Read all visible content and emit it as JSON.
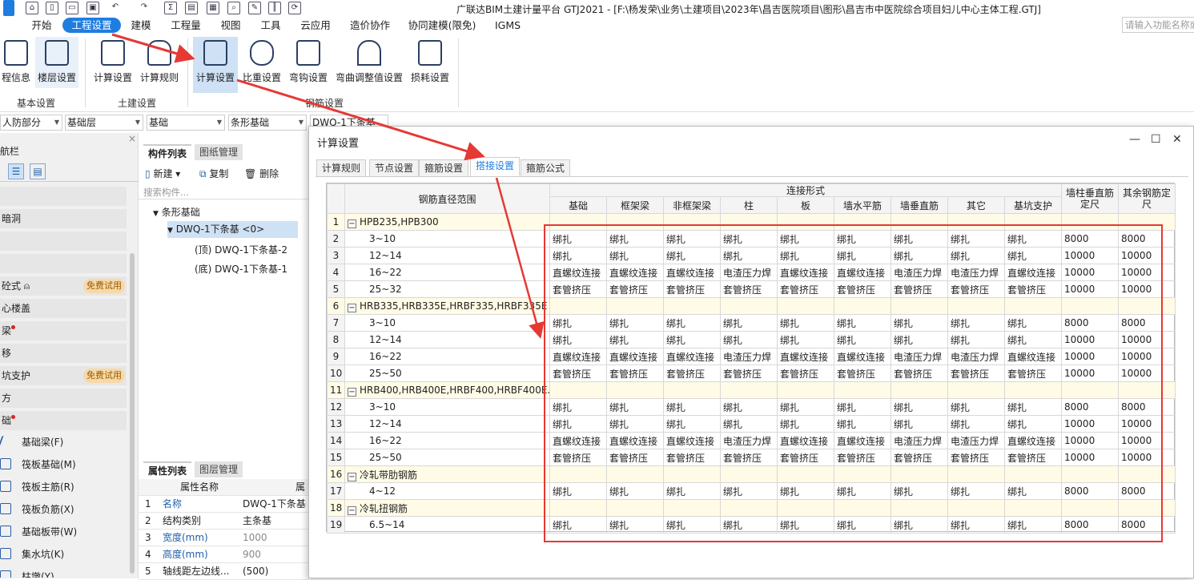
{
  "window": {
    "title": "广联达BIM土建计量平台 GTJ2021 - [F:\\杨发荣\\业务\\土建项目\\2023年\\昌吉医院项目\\图形\\昌吉市中医院综合项目妇儿中心主体工程.GTJ]"
  },
  "menu": {
    "items": [
      "开始",
      "工程设置",
      "建模",
      "工程量",
      "视图",
      "工具",
      "云应用",
      "造价协作",
      "协同建模(限免)",
      "IGMS"
    ],
    "active": "工程设置",
    "search_placeholder": "请输入功能名称或"
  },
  "ribbon": {
    "buttons": [
      "程信息",
      "楼层设置",
      "计算设置",
      "计算规则",
      "计算设置",
      "比重设置",
      "弯钩设置",
      "弯曲调整值设置",
      "损耗设置"
    ],
    "groups": [
      "基本设置",
      "土建设置",
      "钢筋设置"
    ]
  },
  "dropdowns": [
    "人防部分",
    "基础层",
    "基础",
    "条形基础",
    "DWQ-1下条基"
  ],
  "leftnav": {
    "title": "航栏",
    "items": [
      "",
      "暗洞",
      "",
      "",
      "砼式",
      "心楼盖",
      "梁",
      "移",
      "坑支护",
      "方",
      "础"
    ],
    "badge": "免费试用",
    "subitems": [
      "基础梁(F)",
      "筏板基础(M)",
      "筏板主筋(R)",
      "筏板负筋(X)",
      "基础板带(W)",
      "集水坑(K)",
      "柱墩(Y)"
    ]
  },
  "component_panel": {
    "tabs": [
      "构件列表",
      "图纸管理"
    ],
    "toolbar": [
      "新建",
      "复制",
      "删除"
    ],
    "search_placeholder": "搜索构件...",
    "tree": [
      "条形基础",
      "DWQ-1下条基 <0>",
      "(顶) DWQ-1下条基-2",
      "(底) DWQ-1下条基-1"
    ]
  },
  "property_panel": {
    "tabs": [
      "属性列表",
      "图层管理"
    ],
    "header": [
      "属性名称",
      "属"
    ],
    "rows": [
      [
        "1",
        "名称",
        "DWQ-1下条基"
      ],
      [
        "2",
        "结构类别",
        "主条基"
      ],
      [
        "3",
        "宽度(mm)",
        "1000"
      ],
      [
        "4",
        "高度(mm)",
        "900"
      ],
      [
        "5",
        "轴线距左边线...",
        "(500)"
      ]
    ]
  },
  "dialog": {
    "title": "计算设置",
    "tabs": [
      "计算规则",
      "节点设置",
      "箍筋设置",
      "搭接设置",
      "箍筋公式"
    ],
    "active_tab": "搭接设置",
    "table": {
      "header_range": "钢筋直径范围",
      "header_group": "连接形式",
      "columns": [
        "基础",
        "框架梁",
        "非框架梁",
        "柱",
        "板",
        "墙水平筋",
        "墙垂直筋",
        "其它",
        "基坑支护"
      ],
      "extra_columns": [
        "墙柱垂直筋定尺",
        "其余钢筋定尺"
      ],
      "rows": [
        {
          "n": "1",
          "group": true,
          "label": "HPB235,HPB300"
        },
        {
          "n": "2",
          "label": "3~10",
          "cells": [
            "绑扎",
            "绑扎",
            "绑扎",
            "绑扎",
            "绑扎",
            "绑扎",
            "绑扎",
            "绑扎",
            "绑扎",
            "8000",
            "8000"
          ]
        },
        {
          "n": "3",
          "label": "12~14",
          "cells": [
            "绑扎",
            "绑扎",
            "绑扎",
            "绑扎",
            "绑扎",
            "绑扎",
            "绑扎",
            "绑扎",
            "绑扎",
            "10000",
            "10000"
          ]
        },
        {
          "n": "4",
          "label": "16~22",
          "cells": [
            "直螺纹连接",
            "直螺纹连接",
            "直螺纹连接",
            "电渣压力焊",
            "直螺纹连接",
            "直螺纹连接",
            "电渣压力焊",
            "电渣压力焊",
            "直螺纹连接",
            "10000",
            "10000"
          ]
        },
        {
          "n": "5",
          "label": "25~32",
          "cells": [
            "套管挤压",
            "套管挤压",
            "套管挤压",
            "套管挤压",
            "套管挤压",
            "套管挤压",
            "套管挤压",
            "套管挤压",
            "套管挤压",
            "10000",
            "10000"
          ]
        },
        {
          "n": "6",
          "group": true,
          "label": "HRB335,HRB335E,HRBF335,HRBF335E"
        },
        {
          "n": "7",
          "label": "3~10",
          "cells": [
            "绑扎",
            "绑扎",
            "绑扎",
            "绑扎",
            "绑扎",
            "绑扎",
            "绑扎",
            "绑扎",
            "绑扎",
            "8000",
            "8000"
          ]
        },
        {
          "n": "8",
          "label": "12~14",
          "cells": [
            "绑扎",
            "绑扎",
            "绑扎",
            "绑扎",
            "绑扎",
            "绑扎",
            "绑扎",
            "绑扎",
            "绑扎",
            "10000",
            "10000"
          ]
        },
        {
          "n": "9",
          "label": "16~22",
          "cells": [
            "直螺纹连接",
            "直螺纹连接",
            "直螺纹连接",
            "电渣压力焊",
            "直螺纹连接",
            "直螺纹连接",
            "电渣压力焊",
            "电渣压力焊",
            "直螺纹连接",
            "10000",
            "10000"
          ]
        },
        {
          "n": "10",
          "label": "25~50",
          "cells": [
            "套管挤压",
            "套管挤压",
            "套管挤压",
            "套管挤压",
            "套管挤压",
            "套管挤压",
            "套管挤压",
            "套管挤压",
            "套管挤压",
            "10000",
            "10000"
          ]
        },
        {
          "n": "11",
          "group": true,
          "label": "HRB400,HRB400E,HRBF400,HRBF400E..."
        },
        {
          "n": "12",
          "label": "3~10",
          "cells": [
            "绑扎",
            "绑扎",
            "绑扎",
            "绑扎",
            "绑扎",
            "绑扎",
            "绑扎",
            "绑扎",
            "绑扎",
            "8000",
            "8000"
          ]
        },
        {
          "n": "13",
          "label": "12~14",
          "cells": [
            "绑扎",
            "绑扎",
            "绑扎",
            "绑扎",
            "绑扎",
            "绑扎",
            "绑扎",
            "绑扎",
            "绑扎",
            "10000",
            "10000"
          ]
        },
        {
          "n": "14",
          "label": "16~22",
          "cells": [
            "直螺纹连接",
            "直螺纹连接",
            "直螺纹连接",
            "电渣压力焊",
            "直螺纹连接",
            "直螺纹连接",
            "电渣压力焊",
            "电渣压力焊",
            "直螺纹连接",
            "10000",
            "10000"
          ]
        },
        {
          "n": "15",
          "label": "25~50",
          "cells": [
            "套管挤压",
            "套管挤压",
            "套管挤压",
            "套管挤压",
            "套管挤压",
            "套管挤压",
            "套管挤压",
            "套管挤压",
            "套管挤压",
            "10000",
            "10000"
          ]
        },
        {
          "n": "16",
          "group": true,
          "label": "冷轧带肋钢筋"
        },
        {
          "n": "17",
          "label": "4~12",
          "cells": [
            "绑扎",
            "绑扎",
            "绑扎",
            "绑扎",
            "绑扎",
            "绑扎",
            "绑扎",
            "绑扎",
            "绑扎",
            "8000",
            "8000"
          ]
        },
        {
          "n": "18",
          "group": true,
          "label": "冷轧扭钢筋"
        },
        {
          "n": "19",
          "label": "6.5~14",
          "cells": [
            "绑扎",
            "绑扎",
            "绑扎",
            "绑扎",
            "绑扎",
            "绑扎",
            "绑扎",
            "绑扎",
            "绑扎",
            "8000",
            "8000"
          ]
        }
      ]
    }
  },
  "colors": {
    "accent": "#1f7de0",
    "annotation": "#e53935",
    "selected_button": "#cfe1f5"
  }
}
